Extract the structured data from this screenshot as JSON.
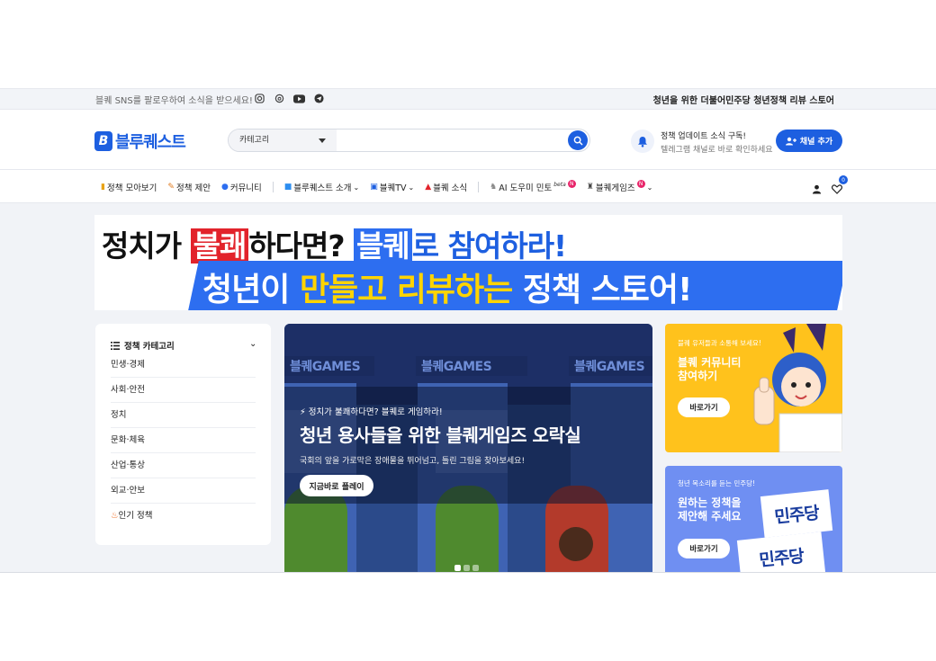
{
  "topbar": {
    "sns_text": "블퀘 SNS를 팔로우하여 소식을 받으세요!",
    "icons": [
      "instagram-icon",
      "threads-icon",
      "youtube-icon",
      "telegram-icon"
    ],
    "right_text": "청년을 위한 더불어민주당 청년정책 리뷰 스토어"
  },
  "header": {
    "logo_text": "블루퀘스트",
    "search_category": "카테고리",
    "search_placeholder": "",
    "subscribe_title": "정책 업데이트 소식 구독!",
    "subscribe_desc": "텔레그램 채널로 바로 확인하세요",
    "add_channel_label": "채널 추가"
  },
  "nav": {
    "items": [
      {
        "label": "정책 모아보기"
      },
      {
        "label": "정책 제안"
      },
      {
        "label": "커뮤니티"
      },
      {
        "label": "블루퀘스트 소개"
      },
      {
        "label": "블퀘TV"
      },
      {
        "label": "블퀘 소식"
      },
      {
        "label": "AI 도우미 민토"
      },
      {
        "label": "블퀘게임즈"
      }
    ],
    "beta": "beta",
    "badge": "N",
    "cart_count": "0"
  },
  "banner": {
    "line1_a": "정치가 ",
    "line1_b": "불쾌",
    "line1_c": "하다면? ",
    "line1_d": "블퀘",
    "line1_e": "로 참여하라!",
    "line2_a": "청년이 ",
    "line2_b": "만들고 리뷰하는",
    "line2_c": " 정책 스토어!"
  },
  "categories": {
    "title": "정책 카테고리",
    "items": [
      "민생·경제",
      "사회·안전",
      "정치",
      "문화·체육",
      "산업·통상",
      "외교·안보",
      "인기 정책"
    ]
  },
  "slide": {
    "marquee": "블퀘GAMES",
    "kicker": "정치가 불쾌하다면? 블퀘로 게임하라!",
    "title": "청년 용사들을 위한 블퀘게임즈 오락실",
    "desc": "국회의 앞을 가로막은 장애물을 뛰어넘고, 틀린 그림을 찾아보세요!",
    "button": "지금바로 플레이"
  },
  "promo1": {
    "small": "블퀘 유저들과 소통해 보세요!",
    "big_1": "블퀘 커뮤니티",
    "big_2": "참여하기",
    "button": "바로가기"
  },
  "promo2": {
    "small": "청년 목소리를 듣는 민주당!",
    "big_1": "원하는 정책을",
    "big_2": "제안해 주세요",
    "button": "바로가기",
    "card_text": "민주당"
  },
  "colors": {
    "brand": "#1d5fe0",
    "banner_red": "#e2232b",
    "promo_yellow": "#ffc21c",
    "promo_blue": "#6f8ff2"
  }
}
